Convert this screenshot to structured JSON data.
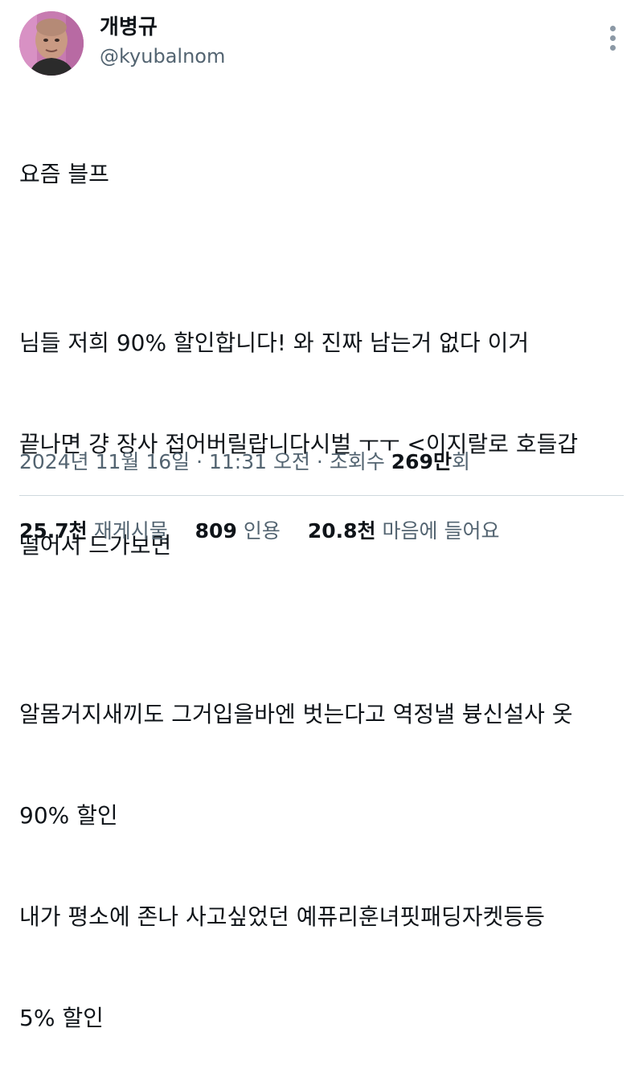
{
  "author": {
    "display_name": "개병규",
    "handle": "@kyubalnom"
  },
  "tweet": {
    "lines": [
      "요즘 블프",
      "",
      "님들 저희 90% 할인합니다! 와 진짜 남는거 없다 이거",
      "끝나면 걍 장사 접어버릴랍니다시벌 ㅜㅜ <이지랄로 호들갑",
      "떨어서 드가보면",
      "",
      "알몸거지새끼도 그거입을바엔 벗는다고 역정낼 븅신설사 옷",
      "90% 할인",
      "내가 평소에 존나 사고싶었던 예퓨리훈녀핏패딩자켓등등",
      "5% 할인"
    ]
  },
  "meta": {
    "date": "2024년 11월 16일",
    "sep1": " · ",
    "time": "11:31 오전",
    "sep2": " · ",
    "views_prefix": "조회수 ",
    "views_count": "269만",
    "views_suffix": "회"
  },
  "stats": {
    "retweets_count": "25.7천",
    "retweets_label": "재게시물",
    "quotes_count": "809",
    "quotes_label": "인용",
    "likes_count": "20.8천",
    "likes_label": "마음에 들어요"
  },
  "colors": {
    "text": "#0f1419",
    "secondary": "#536471",
    "avatar_bg": "#c77bb0"
  },
  "icons": {
    "more": "more-vertical-icon"
  }
}
